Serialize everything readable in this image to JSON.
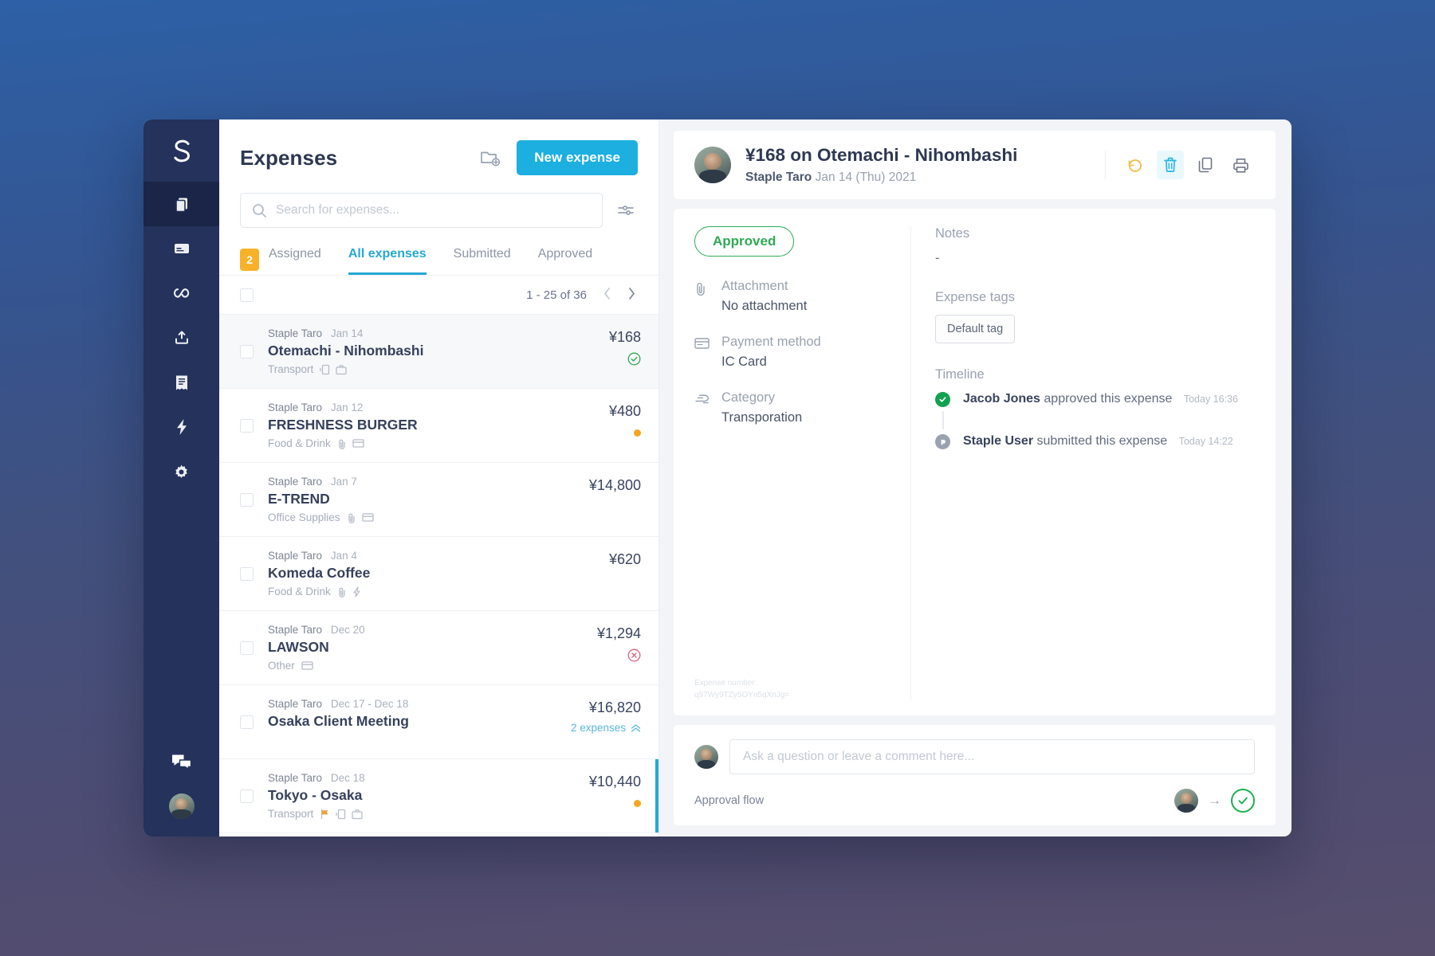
{
  "rail": {
    "logo": "staple-logo",
    "items": [
      {
        "name": "expenses",
        "icon": "documents-icon",
        "active": true
      },
      {
        "name": "cards",
        "icon": "credit-card-icon",
        "active": false
      },
      {
        "name": "integrations",
        "icon": "infinity-icon",
        "active": false
      },
      {
        "name": "export",
        "icon": "upload-icon",
        "active": false
      },
      {
        "name": "reports",
        "icon": "receipt-icon",
        "active": false
      },
      {
        "name": "automation",
        "icon": "lightning-icon",
        "active": false
      },
      {
        "name": "settings",
        "icon": "gear-icon",
        "active": false
      }
    ],
    "bottom": [
      {
        "name": "chat",
        "icon": "chat-bubbles-icon"
      },
      {
        "name": "account",
        "icon": "user-avatar"
      }
    ]
  },
  "list": {
    "title": "Expenses",
    "new_folder_icon": "folder-plus-icon",
    "new_expense_label": "New expense",
    "search": {
      "placeholder": "Search for expenses...",
      "value": "",
      "icon": "search-icon",
      "filter_icon": "sliders-icon"
    },
    "tabs": [
      {
        "label": "Assigned",
        "badge": "2",
        "active": false
      },
      {
        "label": "All expenses",
        "badge": null,
        "active": true
      },
      {
        "label": "Submitted",
        "badge": null,
        "active": false
      },
      {
        "label": "Approved",
        "badge": null,
        "active": false
      }
    ],
    "pagination": {
      "range": "1 - 25 of 36",
      "prev_icon": "chevron-left-icon",
      "next_icon": "chevron-right-icon"
    },
    "rows": [
      {
        "who": "Staple Taro",
        "when": "Jan 14",
        "title": "Otemachi - Nihombashi",
        "category": "Transport",
        "icons": [
          "ic-card-icon",
          "briefcase-icon"
        ],
        "amount": "¥168",
        "status": "approved-check",
        "selected": true,
        "active_bar": false,
        "sub": null
      },
      {
        "who": "Staple Taro",
        "when": "Jan 12",
        "title": "FRESHNESS BURGER",
        "category": "Food & Drink",
        "icons": [
          "paperclip-icon",
          "card-icon"
        ],
        "amount": "¥480",
        "status": "pending-dot",
        "selected": false,
        "active_bar": false,
        "sub": null
      },
      {
        "who": "Staple Taro",
        "when": "Jan 7",
        "title": "E-TREND",
        "category": "Office Supplies",
        "icons": [
          "paperclip-icon",
          "card-icon"
        ],
        "amount": "¥14,800",
        "status": "none",
        "selected": false,
        "active_bar": false,
        "sub": null
      },
      {
        "who": "Staple Taro",
        "when": "Jan 4",
        "title": "Komeda Coffee",
        "category": "Food & Drink",
        "icons": [
          "paperclip-icon",
          "lightning-icon"
        ],
        "amount": "¥620",
        "status": "none",
        "selected": false,
        "active_bar": false,
        "sub": null
      },
      {
        "who": "Staple Taro",
        "when": "Dec 20",
        "title": "LAWSON",
        "category": "Other",
        "icons": [
          "card-icon"
        ],
        "amount": "¥1,294",
        "status": "rejected-x",
        "selected": false,
        "active_bar": false,
        "sub": null
      },
      {
        "who": "Staple Taro",
        "when": "Dec 17 - Dec 18",
        "title": "Osaka Client Meeting",
        "category": "",
        "icons": [],
        "amount": "¥16,820",
        "status": "none",
        "selected": false,
        "active_bar": false,
        "sub": "2 expenses"
      },
      {
        "who": "Staple Taro",
        "when": "Dec 18",
        "title": "Tokyo - Osaka",
        "category": "Transport",
        "icons": [
          "flag-icon",
          "ic-card-icon",
          "briefcase-icon"
        ],
        "amount": "¥10,440",
        "status": "pending-dot",
        "selected": false,
        "active_bar": true,
        "sub": null
      }
    ]
  },
  "detail": {
    "title": "¥168 on Otemachi - Nihombashi",
    "author": "Staple Taro",
    "date": "Jan 14 (Thu) 2021",
    "avatar": "user-avatar",
    "tools": [
      {
        "name": "undo",
        "icon": "undo-icon"
      },
      {
        "name": "delete",
        "icon": "trash-icon"
      },
      {
        "name": "duplicate",
        "icon": "copy-icon"
      },
      {
        "name": "print",
        "icon": "printer-icon"
      }
    ],
    "status_pill": "Approved",
    "fields": [
      {
        "label": "Attachment",
        "value": "No attachment",
        "icon": "paperclip-icon"
      },
      {
        "label": "Payment method",
        "value": "IC Card",
        "icon": "card-icon"
      },
      {
        "label": "Category",
        "value": "Transporation",
        "icon": "train-icon"
      }
    ],
    "expense_number_label": "Expense number:",
    "expense_number_value": "q97Wy9TZy5OYn5qXnJg=",
    "notes_label": "Notes",
    "notes_value": "-",
    "tags_label": "Expense tags",
    "tags": [
      "Default tag"
    ],
    "timeline_label": "Timeline",
    "timeline": [
      {
        "actor": "Jacob Jones",
        "action": "approved this expense",
        "time": "Today 16:36",
        "state": "green"
      },
      {
        "actor": "Staple User",
        "action": "submitted this expense",
        "time": "Today 14:22",
        "state": "gray"
      }
    ],
    "comment": {
      "placeholder": "Ask a question or leave a comment here...",
      "value": ""
    },
    "approval_flow_label": "Approval flow",
    "approval_arrow": "→"
  },
  "colors": {
    "accent": "#1cafe0",
    "approved": "#2faa55",
    "pending": "#f5a623",
    "rejected": "#e0607e",
    "badge": "#f8b229",
    "rail": "#24325c"
  }
}
